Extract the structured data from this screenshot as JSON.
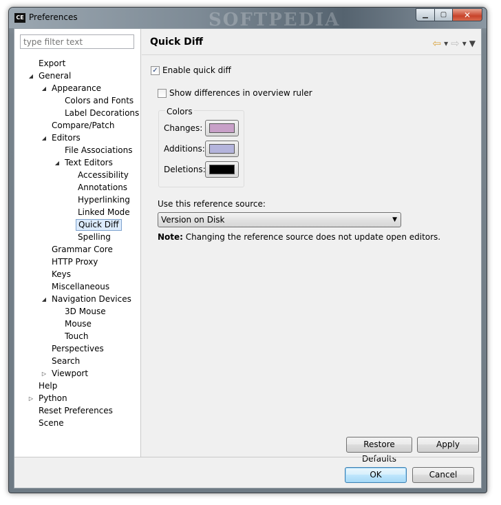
{
  "window": {
    "app_icon": "CE",
    "title": "Preferences",
    "watermark": "SOFTPEDIA",
    "minimize_glyph": "▁",
    "maximize_glyph": "▢",
    "close_glyph": "✕"
  },
  "filter": {
    "placeholder": "type filter text",
    "value": ""
  },
  "tree": [
    {
      "label": "Export",
      "level": 0,
      "state": "leaf"
    },
    {
      "label": "General",
      "level": 0,
      "state": "expanded"
    },
    {
      "label": "Appearance",
      "level": 1,
      "state": "expanded"
    },
    {
      "label": "Colors and Fonts",
      "level": 2,
      "state": "leaf"
    },
    {
      "label": "Label Decorations",
      "level": 2,
      "state": "leaf"
    },
    {
      "label": "Compare/Patch",
      "level": 1,
      "state": "leaf"
    },
    {
      "label": "Editors",
      "level": 1,
      "state": "expanded"
    },
    {
      "label": "File Associations",
      "level": 2,
      "state": "leaf"
    },
    {
      "label": "Text Editors",
      "level": 2,
      "state": "expanded"
    },
    {
      "label": "Accessibility",
      "level": 3,
      "state": "leaf"
    },
    {
      "label": "Annotations",
      "level": 3,
      "state": "leaf"
    },
    {
      "label": "Hyperlinking",
      "level": 3,
      "state": "leaf"
    },
    {
      "label": "Linked Mode",
      "level": 3,
      "state": "leaf"
    },
    {
      "label": "Quick Diff",
      "level": 3,
      "state": "leaf",
      "selected": true
    },
    {
      "label": "Spelling",
      "level": 3,
      "state": "leaf"
    },
    {
      "label": "Grammar Core",
      "level": 1,
      "state": "leaf"
    },
    {
      "label": "HTTP Proxy",
      "level": 1,
      "state": "leaf"
    },
    {
      "label": "Keys",
      "level": 1,
      "state": "leaf"
    },
    {
      "label": "Miscellaneous",
      "level": 1,
      "state": "leaf"
    },
    {
      "label": "Navigation Devices",
      "level": 1,
      "state": "expanded"
    },
    {
      "label": "3D Mouse",
      "level": 2,
      "state": "leaf"
    },
    {
      "label": "Mouse",
      "level": 2,
      "state": "leaf"
    },
    {
      "label": "Touch",
      "level": 2,
      "state": "leaf"
    },
    {
      "label": "Perspectives",
      "level": 1,
      "state": "leaf"
    },
    {
      "label": "Search",
      "level": 1,
      "state": "leaf"
    },
    {
      "label": "Viewport",
      "level": 1,
      "state": "collapsed"
    },
    {
      "label": "Help",
      "level": 0,
      "state": "leaf"
    },
    {
      "label": "Python",
      "level": 0,
      "state": "collapsed"
    },
    {
      "label": "Reset Preferences",
      "level": 0,
      "state": "leaf"
    },
    {
      "label": "Scene",
      "level": 0,
      "state": "leaf"
    }
  ],
  "page": {
    "title": "Quick Diff",
    "nav": {
      "back": "⇦",
      "back_menu": "▾",
      "forward": "⇨",
      "forward_menu": "▾",
      "view_menu": "▼"
    },
    "enable_quick_diff": {
      "label": "Enable quick diff",
      "checked": true
    },
    "show_overview": {
      "label": "Show differences in overview ruler",
      "checked": false
    },
    "colors": {
      "legend": "Colors",
      "changes": {
        "label": "Changes:",
        "color": "#c8a0c8"
      },
      "additions": {
        "label": "Additions:",
        "color": "#b4b4dc"
      },
      "deletions": {
        "label": "Deletions:",
        "color": "#000000"
      }
    },
    "reference": {
      "label": "Use this reference source:",
      "selected": "Version on Disk",
      "arrow": "▼"
    },
    "note": {
      "bold": "Note:",
      "text": " Changing the reference source does not update open editors."
    },
    "restore_defaults": "Restore Defaults",
    "apply": "Apply"
  },
  "dialog": {
    "ok": "OK",
    "cancel": "Cancel"
  },
  "glyphs": {
    "expanded": "◢",
    "collapsed": "▷",
    "check": "✓"
  }
}
